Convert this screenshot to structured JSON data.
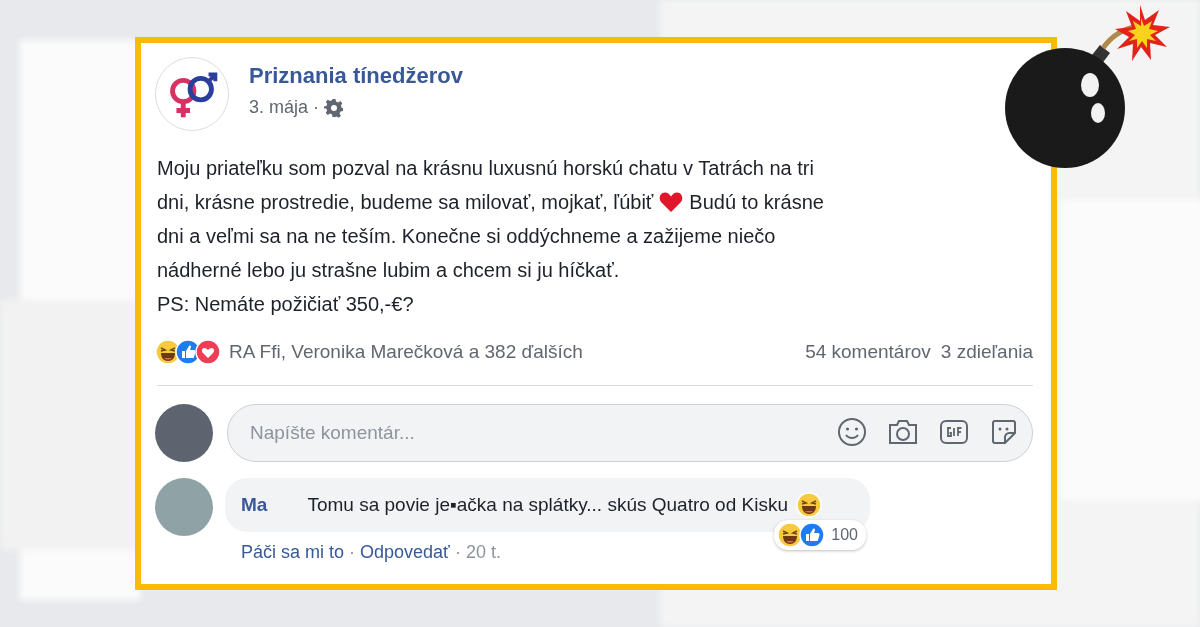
{
  "post": {
    "page_name": "Priznania tínedžerov",
    "date": "3. mája",
    "date_separator": "·",
    "lines": [
      [
        {
          "kind": "text",
          "text": "Moju priateľku som pozval na krásnu luxusnú horskú chatu v Tatrách na tri"
        }
      ],
      [
        {
          "kind": "text",
          "text": "dni, krásne prostredie, budeme sa milovať, mojkať, ľúbiť"
        },
        {
          "kind": "heart"
        },
        {
          "kind": "text",
          "text": "Budú to krásne"
        }
      ],
      [
        {
          "kind": "text",
          "text": "dni a veľmi sa na ne teším. Konečne si oddýchneme a zažijeme niečo"
        }
      ],
      [
        {
          "kind": "text",
          "text": "nádherné lebo ju strašne lubim a chcem si ju híčkať."
        }
      ]
    ],
    "ps": "PS: Nemáte požičiať 350,-€?",
    "reactions_text": "RA Ffi, Veronika Marečková a 382 ďalších",
    "comments_count": "54 komentárov",
    "shares_count": "3 zdieľania"
  },
  "comment_box": {
    "placeholder": "Napíšte komentár..."
  },
  "comment": {
    "author": "Ma",
    "text": "Tomu sa povie je▪ačka na splátky... skús Quatro od Kisku",
    "reaction_count": "100",
    "actions": [
      {
        "kind": "link",
        "text": "Páči sa mi to"
      },
      {
        "kind": "separator",
        "text": "·"
      },
      {
        "kind": "link",
        "text": "Odpovedať"
      },
      {
        "kind": "separator",
        "text": "·"
      },
      {
        "kind": "time",
        "text": "20 t."
      }
    ]
  }
}
